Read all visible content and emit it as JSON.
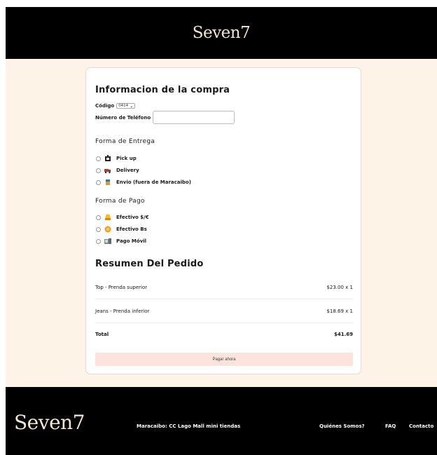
{
  "brand": "Seven7",
  "checkout": {
    "title": "Informacion de la compra",
    "codigo_label": "Código",
    "codigo_value": "0414",
    "telefono_label": "Número de Teléfono",
    "telefono_value": "",
    "entrega_title": "Forma de Entrega",
    "entrega_options": [
      {
        "label": "Pick up",
        "icon": "pickup-icon"
      },
      {
        "label": "Delivery",
        "icon": "delivery-icon"
      },
      {
        "label": "Envio (fuera de Maracaibo)",
        "icon": "package-icon"
      }
    ],
    "pago_title": "Forma de Pago",
    "pago_options": [
      {
        "label": "Efectivo $/€",
        "icon": "cash-usd-icon"
      },
      {
        "label": "Efectivo Bs",
        "icon": "coin-icon"
      },
      {
        "label": "Pago Móvil",
        "icon": "mobile-pay-icon"
      }
    ]
  },
  "summary": {
    "title": "Resumen Del Pedido",
    "items": [
      {
        "name": "Top - Prenda superior",
        "price": "$23.00 x 1"
      },
      {
        "name": "Jeans - Prenda inferior",
        "price": "$18.69 x 1"
      }
    ],
    "total_label": "Total",
    "total_value": "$41.69",
    "pay_button": "Pagar ahora"
  },
  "footer": {
    "brand": "Seven7",
    "address": "Maracaibo: CC Lago Mall mini tiendas",
    "links": [
      "Quiénes Somos?",
      "FAQ",
      "Contacto"
    ]
  },
  "colors": {
    "header_bg": "#000000",
    "page_bg": "#fdf3e6",
    "pay_button_bg": "#fce4dd"
  }
}
